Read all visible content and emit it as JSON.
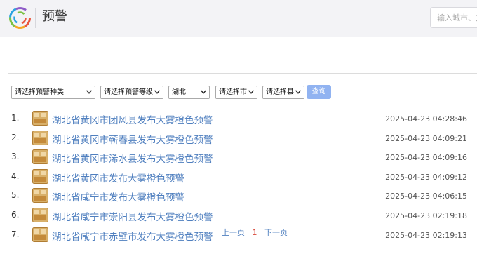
{
  "header": {
    "title": "预警",
    "search_placeholder": "输入城市、关"
  },
  "filters": {
    "type_label": "请选择预警种类",
    "level_label": "请选择预警等级",
    "province_label": "湖北",
    "city_label": "请选择市",
    "county_label": "请选择县",
    "query_label": "查询"
  },
  "warnings": [
    {
      "index": "1.",
      "title": "湖北省黄冈市团风县发布大雾橙色预警",
      "time": "2025-04-23 04:28:46"
    },
    {
      "index": "2.",
      "title": "湖北省黄冈市蕲春县发布大雾橙色预警",
      "time": "2025-04-23 04:09:21"
    },
    {
      "index": "3.",
      "title": "湖北省黄冈市浠水县发布大雾橙色预警",
      "time": "2025-04-23 04:09:16"
    },
    {
      "index": "4.",
      "title": "湖北省黄冈市发布大雾橙色预警",
      "time": "2025-04-23 04:09:12"
    },
    {
      "index": "5.",
      "title": "湖北省咸宁市发布大雾橙色预警",
      "time": "2025-04-23 04:06:15"
    },
    {
      "index": "6.",
      "title": "湖北省咸宁市崇阳县发布大雾橙色预警",
      "time": "2025-04-23 02:19:18"
    },
    {
      "index": "7.",
      "title": "湖北省咸宁市赤壁市发布大雾橙色预警",
      "time": "2025-04-23 02:19:13"
    }
  ],
  "pager": {
    "prev_label": "上一页",
    "current_page": "1",
    "next_label": "下一页"
  },
  "colors": {
    "link": "#4f7fbf",
    "query_button": "#91b3f1",
    "header_bg": "#f3f3f6",
    "warning_icon": "#c79a4e"
  }
}
